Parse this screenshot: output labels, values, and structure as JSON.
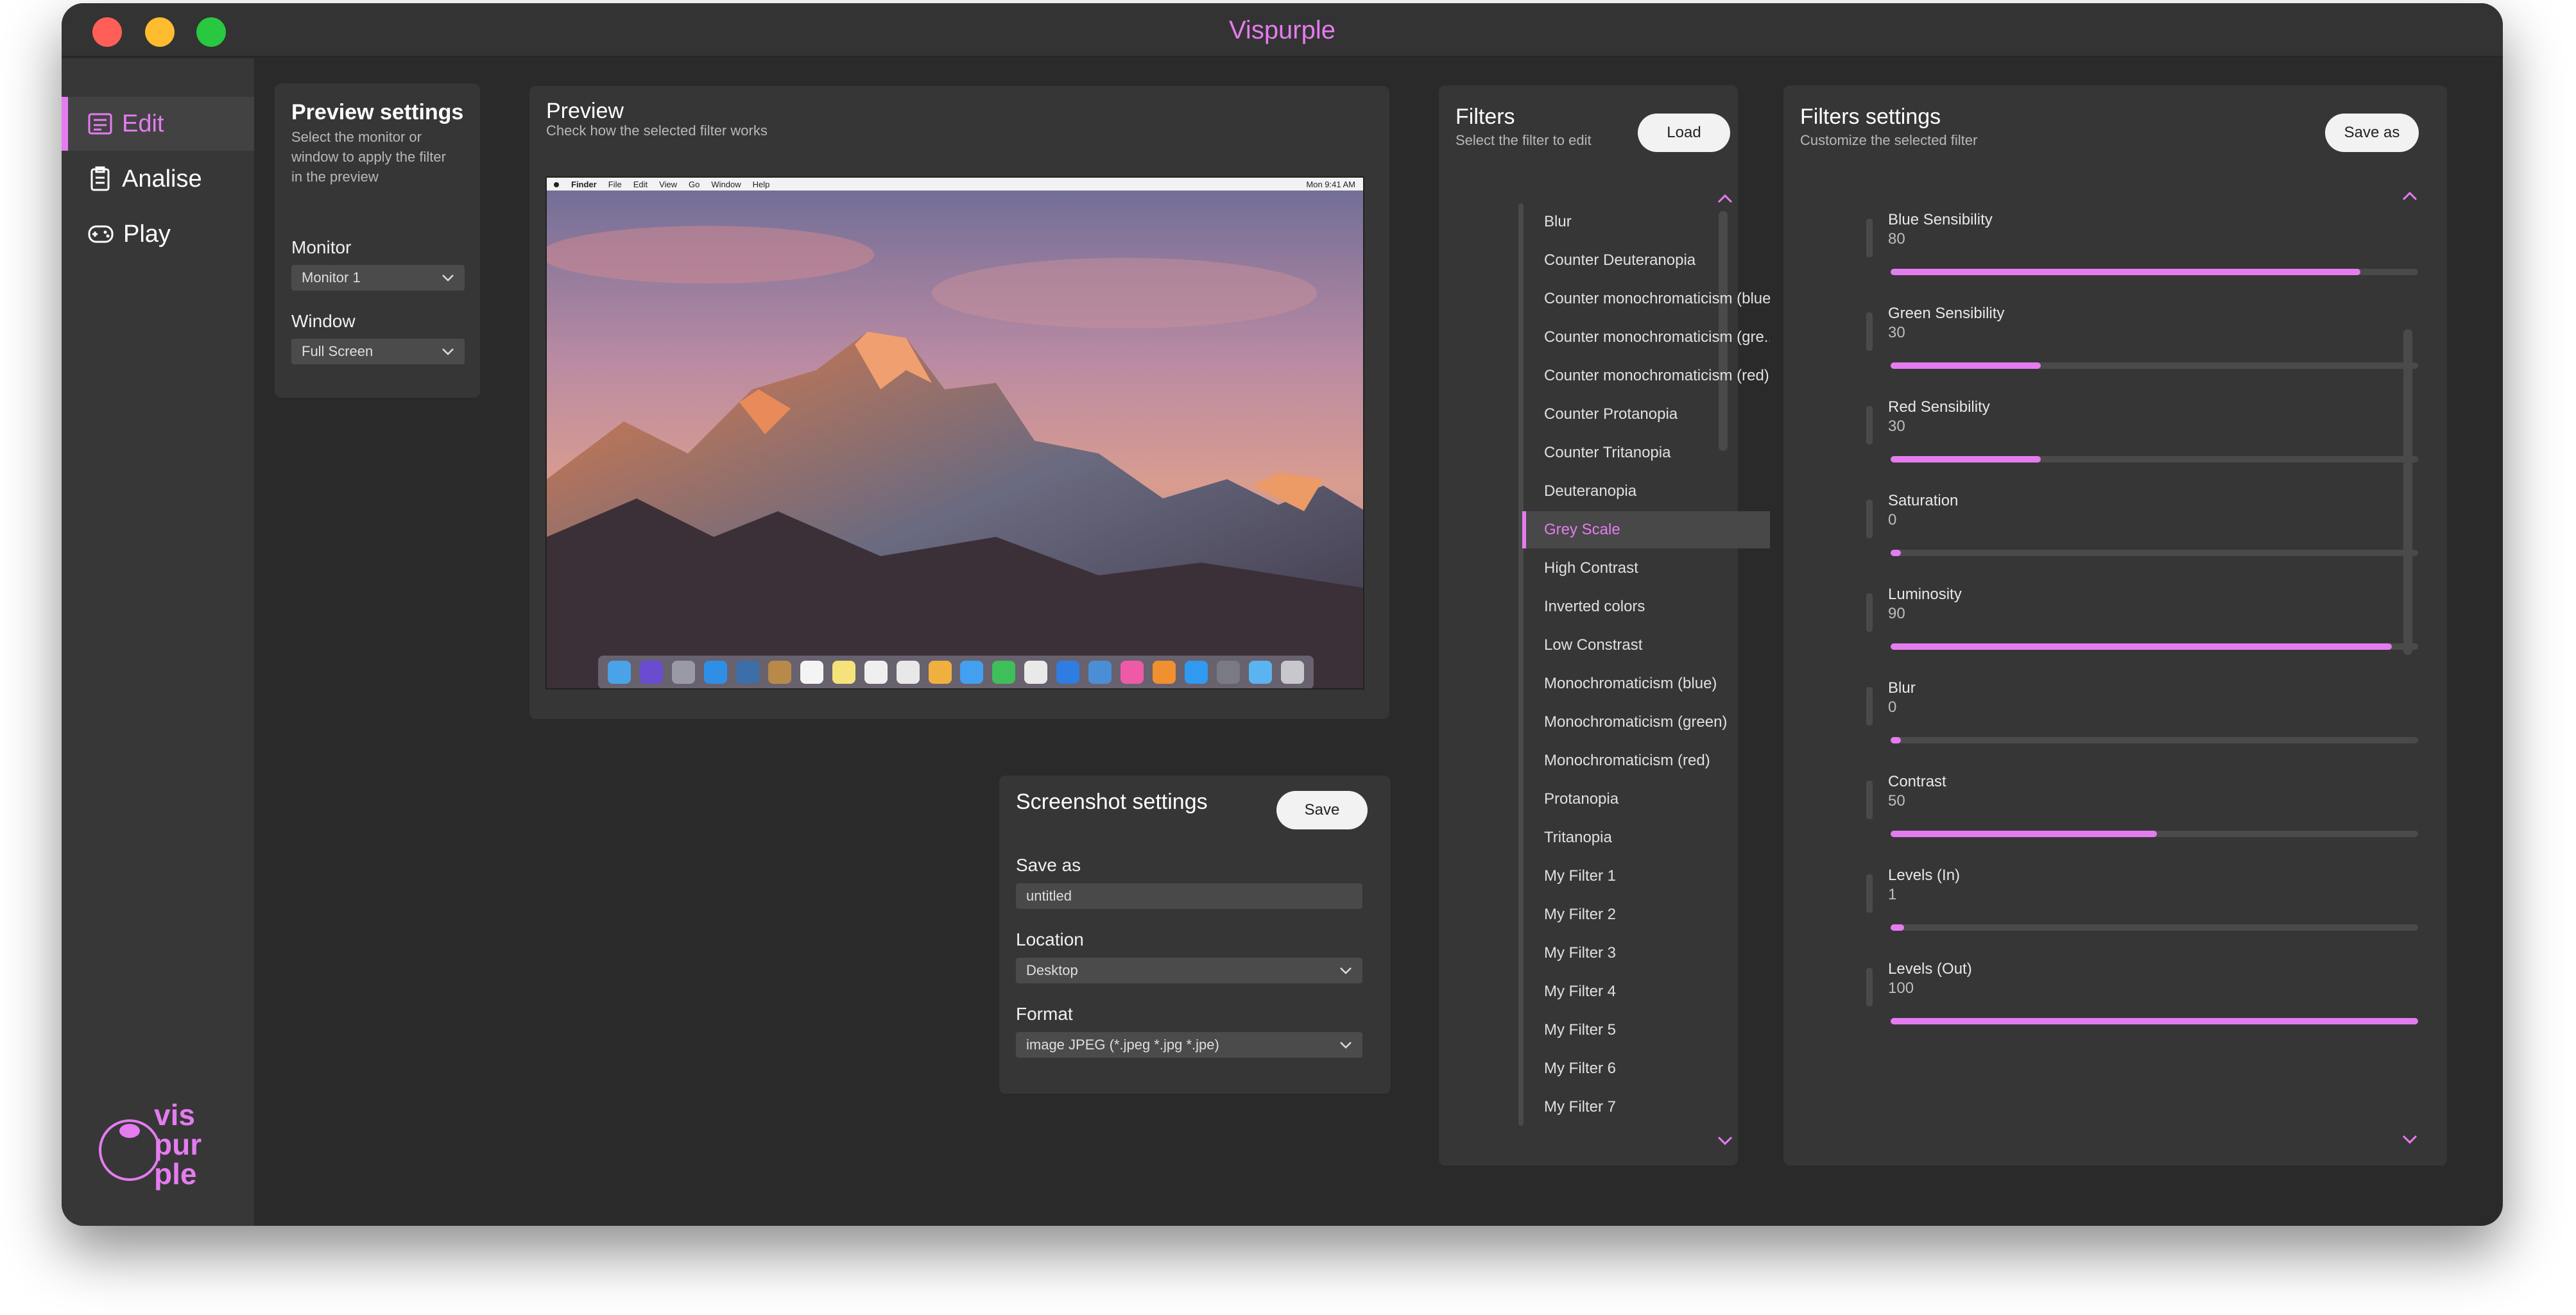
{
  "app": {
    "title": "Vispurple",
    "accent": "#e47cf0"
  },
  "sidebar": {
    "items": [
      {
        "label": "Edit",
        "icon": "edit-icon",
        "active": true
      },
      {
        "label": "Analise",
        "icon": "clipboard-icon",
        "active": false
      },
      {
        "label": "Play",
        "icon": "gamepad-icon",
        "active": false
      }
    ],
    "logo": {
      "line1": "vis",
      "line2": "pur",
      "line3": "ple"
    }
  },
  "preview_settings": {
    "title": "Preview settings",
    "subtitle_lines": [
      "Select the monitor or",
      "window to apply the filter",
      "in the preview"
    ],
    "monitor_label": "Monitor",
    "monitor_value": "Monitor 1",
    "window_label": "Window",
    "window_value": "Full Screen"
  },
  "preview": {
    "title": "Preview",
    "subtitle": "Check how the selected filter works",
    "menubar": [
      "Finder",
      "File",
      "Edit",
      "View",
      "Go",
      "Window",
      "Help"
    ],
    "clock": "Mon 9:41 AM"
  },
  "screenshot_settings": {
    "title": "Screenshot settings",
    "save_button": "Save",
    "save_as_label": "Save as",
    "save_as_value": "untitled",
    "location_label": "Location",
    "location_value": "Desktop",
    "format_label": "Format",
    "format_value": "image JPEG (*.jpeg *.jpg *.jpe)"
  },
  "filters": {
    "title": "Filters",
    "subtitle": "Select the filter to edit",
    "load_button": "Load",
    "items": [
      "Blur",
      "Counter Deuteranopia",
      "Counter monochromaticism (blue)",
      "Counter monochromaticism (gre...",
      "Counter monochromaticism (red)",
      "Counter Protanopia",
      "Counter Tritanopia",
      "Deuteranopia",
      "Grey Scale",
      "High Contrast",
      "Inverted colors",
      "Low Constrast",
      "Monochromaticism (blue)",
      "Monochromaticism (green)",
      "Monochromaticism (red)",
      "Protanopia",
      "Tritanopia",
      "My Filter 1",
      "My Filter 2",
      "My Filter 3",
      "My Filter 4",
      "My Filter 5",
      "My Filter 6",
      "My Filter 7"
    ],
    "selected": "Grey Scale"
  },
  "filter_settings": {
    "title": "Filters settings",
    "subtitle": "Customize the selected filter",
    "save_as_button": "Save as",
    "items": [
      {
        "name": "Blue Sensibility",
        "value": "80",
        "fraction": 0.89
      },
      {
        "name": "Green Sensibility",
        "value": "30",
        "fraction": 0.285
      },
      {
        "name": "Red Sensibility",
        "value": "30",
        "fraction": 0.285
      },
      {
        "name": "Saturation",
        "value": "0",
        "fraction": 0.02
      },
      {
        "name": "Luminosity",
        "value": "90",
        "fraction": 0.95
      },
      {
        "name": "Blur",
        "value": "0",
        "fraction": 0.02
      },
      {
        "name": "Contrast",
        "value": "50",
        "fraction": 0.505
      },
      {
        "name": "Levels (In)",
        "value": "1",
        "fraction": 0.025
      },
      {
        "name": "Levels (Out)",
        "value": "100",
        "fraction": 1.0
      }
    ]
  }
}
